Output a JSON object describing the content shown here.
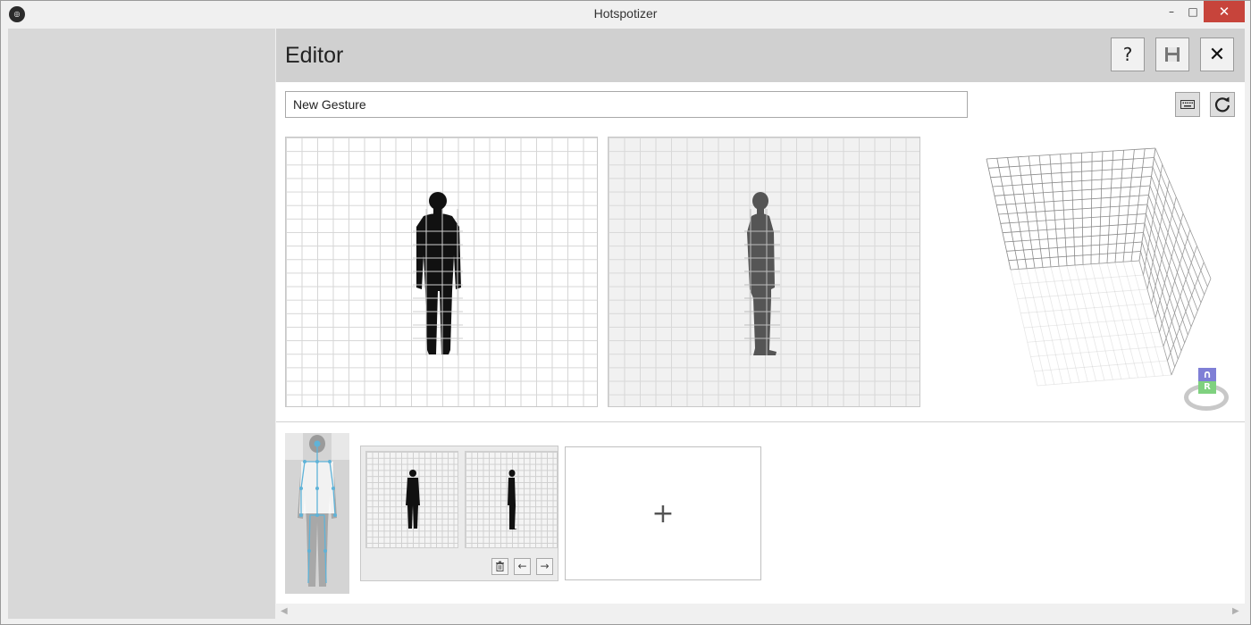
{
  "window": {
    "title": "Hotspotizer",
    "minimize": "–",
    "maximize": "□",
    "close": "✕"
  },
  "editor": {
    "title": "Editor",
    "help_label": "?",
    "close_label": "✕",
    "gesture_name": "New Gesture"
  },
  "frames": {
    "add_label": "+",
    "prev_label": "←",
    "next_label": "→",
    "delete_label": "🗑"
  },
  "view_cube": {
    "top_face": "∩",
    "front_face": "R"
  },
  "colors": {
    "accent_blue": "#5fb3d8",
    "close_red": "#c7443b",
    "cube_top": "#7f7fd6",
    "cube_front": "#7fd17f"
  },
  "icons": [
    "app-icon",
    "save-icon",
    "keyboard-icon",
    "reset-icon",
    "trash-icon",
    "arrow-left-icon",
    "arrow-right-icon"
  ]
}
